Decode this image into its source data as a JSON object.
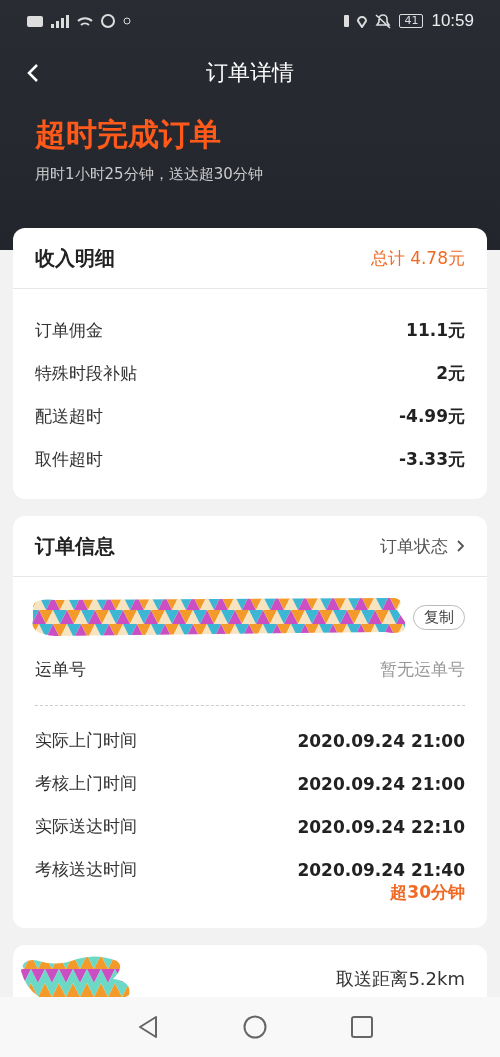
{
  "status_bar": {
    "battery": "41",
    "time": "10:59"
  },
  "nav": {
    "title": "订单详情"
  },
  "banner": {
    "title": "超时完成订单",
    "subtitle": "用时1小时25分钟，送达超30分钟"
  },
  "income": {
    "title": "收入明细",
    "total": "总计 4.78元",
    "rows": [
      {
        "label": "订单佣金",
        "value": "11.1元"
      },
      {
        "label": "特殊时段补贴",
        "value": "2元"
      },
      {
        "label": "配送超时",
        "value": "-4.99元"
      },
      {
        "label": "取件超时",
        "value": "-3.33元"
      }
    ]
  },
  "order_info": {
    "title": "订单信息",
    "link": "订单状态",
    "copy_button": "复制",
    "waybill": {
      "label": "运单号",
      "value": "暂无运单号"
    },
    "times": [
      {
        "label": "实际上门时间",
        "value": "2020.09.24 21:00"
      },
      {
        "label": "考核上门时间",
        "value": "2020.09.24 21:00"
      },
      {
        "label": "实际送达时间",
        "value": "2020.09.24 22:10"
      },
      {
        "label": "考核送达时间",
        "value": "2020.09.24 21:40"
      }
    ],
    "overtime_note": "超30分钟"
  },
  "distance": {
    "text": "取送距离5.2km"
  }
}
